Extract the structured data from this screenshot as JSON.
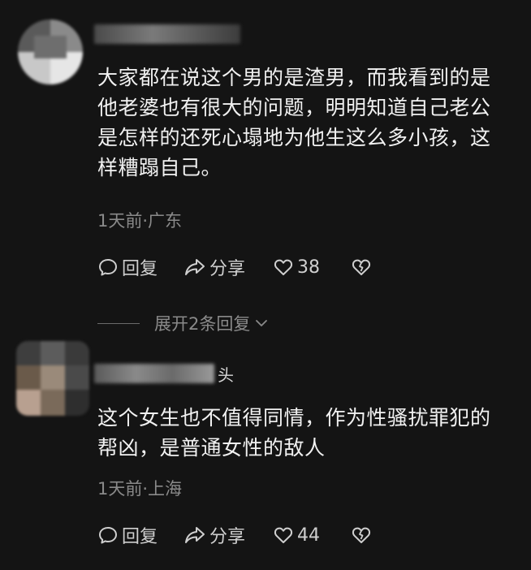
{
  "comments": [
    {
      "username_suffix": "",
      "text": "大家都在说这个男的是渣男，而我看到的是他老婆也有很大的问题，明明知道自己老公是怎样的还死心塌地为他生这么多小孩，这样糟蹋自己。",
      "meta": "1天前·广东",
      "reply_label": "回复",
      "share_label": "分享",
      "like_count": "38"
    },
    {
      "username_suffix": "头",
      "text": "这个女生也不值得同情，作为性骚扰罪犯的帮凶，是普通女性的敌人",
      "meta": "1天前·上海",
      "reply_label": "回复",
      "share_label": "分享",
      "like_count": "44"
    }
  ],
  "expand_replies": {
    "label": "展开2条回复"
  },
  "icons": {
    "reply": "speech-bubble-icon",
    "share": "share-arrow-icon",
    "like": "heart-icon",
    "dislike": "broken-heart-icon",
    "expand": "chevron-down-icon"
  },
  "colors": {
    "background": "#141414",
    "text": "#f1f1f1",
    "meta": "#8a8a8a",
    "action": "#cfcfcf"
  }
}
